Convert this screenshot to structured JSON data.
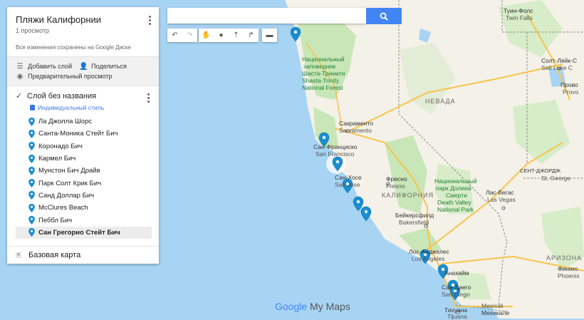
{
  "panel": {
    "title": "Пляжи Калифорнии",
    "views": "1 просмотр",
    "saved": "Все изменения сохранены на Google Диске",
    "add_layer": "Добавить слой",
    "share": "Поделиться",
    "preview": "Предварительный просмотр",
    "layer_name": "Слой без названия",
    "style": "Индивидуальный стиль",
    "places": [
      "Ла Джолла Шорс",
      "Санта-Моника Стейт Бич",
      "Коронадо Бич",
      "Кармел Бич",
      "Мунстон Бич Драйв",
      "Парк Солт Крик Бич",
      "Санд Доллар Бич",
      "McClures Beach",
      "Пеббл Бич",
      "Сан Грегорио Стейт Бич"
    ],
    "base_map": "Базовая карта"
  },
  "search": {
    "value": ""
  },
  "watermark": {
    "google": "Google",
    "mymaps": "My Maps"
  },
  "map": {
    "labels": [
      {
        "t": "Национальный",
        "c": "park"
      },
      {
        "t": "заповедник",
        "c": "park"
      },
      {
        "t": "Шаста-Тринити",
        "c": "park"
      },
      {
        "t": "Shasta-Trinity",
        "c": "park"
      },
      {
        "t": "National Forest",
        "c": "park"
      },
      {
        "t": "Сакраменто",
        "c": ""
      },
      {
        "t": "Sacramento",
        "c": "en"
      },
      {
        "t": "Сан-Франциско",
        "c": ""
      },
      {
        "t": "San Francisco",
        "c": "en"
      },
      {
        "t": "Сан-Хосе",
        "c": ""
      },
      {
        "t": "San Jose",
        "c": "en"
      },
      {
        "t": "Фресно",
        "c": ""
      },
      {
        "t": "Fresno",
        "c": "en"
      },
      {
        "t": "КАЛИФОРНИЯ",
        "c": "state"
      },
      {
        "t": "Бейкерсфилд",
        "c": ""
      },
      {
        "t": "Bakersfield",
        "c": "en"
      },
      {
        "t": "Лос-Анджелес",
        "c": ""
      },
      {
        "t": "Los Angeles",
        "c": "en"
      },
      {
        "t": "Анахайм",
        "c": ""
      },
      {
        "t": "Сан-Диего",
        "c": ""
      },
      {
        "t": "San Diego",
        "c": "en"
      },
      {
        "t": "Тихуана",
        "c": ""
      },
      {
        "t": "Tijuana",
        "c": "en"
      },
      {
        "t": "Mexicali",
        "c": "en"
      },
      {
        "t": "Мехикали",
        "c": ""
      },
      {
        "t": "НЕВАДА",
        "c": "state"
      },
      {
        "t": "Национальный",
        "c": "park"
      },
      {
        "t": "парк Долина",
        "c": "park"
      },
      {
        "t": "Смерти",
        "c": "park"
      },
      {
        "t": "Death Valley",
        "c": "park"
      },
      {
        "t": "National Park",
        "c": "park"
      },
      {
        "t": "Лас-Вегас",
        "c": ""
      },
      {
        "t": "Las Vegas",
        "c": "en"
      },
      {
        "t": "АРИЗОНА",
        "c": "state"
      },
      {
        "t": "Финикс",
        "c": ""
      },
      {
        "t": "Phoenix",
        "c": "en"
      },
      {
        "t": "Туин-Фолс",
        "c": ""
      },
      {
        "t": "Twin Falls",
        "c": "en"
      },
      {
        "t": "Солт-Лейк-С",
        "c": ""
      },
      {
        "t": "Salt Lake C",
        "c": "en"
      },
      {
        "t": "Прово",
        "c": ""
      },
      {
        "t": "Provo",
        "c": "en"
      },
      {
        "t": "СЕНТ-ДЖОРДЖ",
        "c": ""
      },
      {
        "t": "St. George",
        "c": "en"
      }
    ]
  }
}
